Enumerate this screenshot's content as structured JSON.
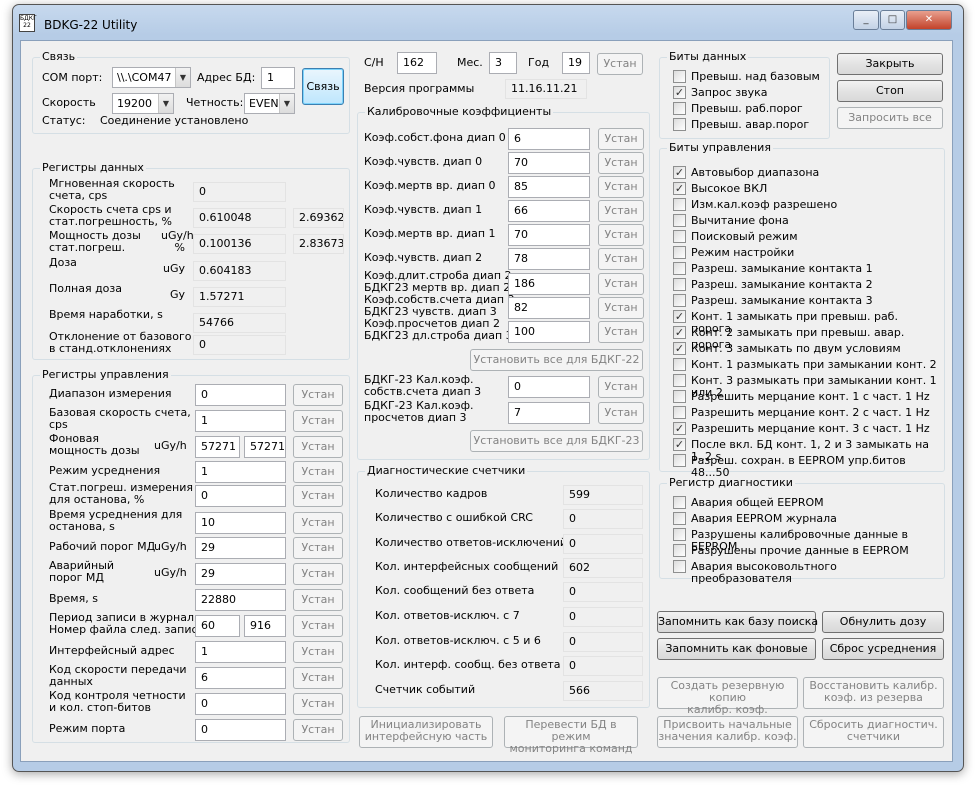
{
  "app": {
    "title": "BDKG-22 Utility",
    "icon_text": "БДКГ\n22",
    "caption_buttons": [
      "minimize-icon",
      "maximize-icon",
      "close-icon"
    ]
  },
  "link": {
    "title": "Связь",
    "com_label": "COM порт:",
    "com_value": "\\\\.\\COM47",
    "addr_label": "Адрес БД:",
    "addr_value": "1",
    "connect_btn": "Связь",
    "speed_label": "Скорость",
    "speed_value": "19200",
    "parity_label": "Четность:",
    "parity_value": "EVEN",
    "status_label": "Статус:",
    "status_value": "Соединение установлено"
  },
  "data_regs": {
    "title": "Регистры данных",
    "rows": [
      {
        "label": "Мгновенная скорость\nсчета, cps",
        "value": "0"
      },
      {
        "label": "Скорость счета cps и\nстат.погрешность, %",
        "value": "0.610048",
        "value2": "2.69362"
      },
      {
        "label": "Мощность дозы\nстат.погреш.",
        "unit": "uGy/h\n%",
        "value": "0.100136",
        "value2": "2.83673"
      },
      {
        "label": "Доза",
        "unit": "uGy",
        "value": "0.604183"
      },
      {
        "label": "Полная доза",
        "unit": "Gy",
        "value": "1.57271"
      },
      {
        "label": "Время наработки, s",
        "value": "54766"
      },
      {
        "label": "Отклонение от базового\nв станд.отклонениях",
        "value": "0"
      }
    ]
  },
  "ctrl_regs": {
    "title": "Регистры управления",
    "set_label": "Устан",
    "rows": [
      {
        "label": "Диапазон измерения",
        "value": "0"
      },
      {
        "label": "Базовая скорость счета,\ncps",
        "value": "1"
      },
      {
        "label": "Фоновая\nмощность дозы",
        "unit": "uGy/h",
        "value": "57271",
        "value2": "57271"
      },
      {
        "label": "Режим усреднения",
        "value": "1"
      },
      {
        "label": "Стат.погреш. измерения\nдля останова, %",
        "value": "0"
      },
      {
        "label": "Время усреднения для\nостанова, s",
        "value": "10"
      },
      {
        "label": "Рабочий порог МД",
        "unit": "uGy/h",
        "value": "29"
      },
      {
        "label": "Аварийный\nпорог МД",
        "unit": "uGy/h",
        "value": "29"
      },
      {
        "label": "Время, s",
        "value": "22880"
      },
      {
        "label": "Период записи в журнал,\nНомер файла след. записи",
        "value": "60",
        "value2": "916"
      },
      {
        "label": "Интерфейсный адрес",
        "value": "1"
      },
      {
        "label": "Код скорости передачи\nданных",
        "value": "6"
      },
      {
        "label": "Код контроля четности\nи кол. стоп-битов",
        "value": "0"
      },
      {
        "label": "Режим порта",
        "value": "0"
      }
    ]
  },
  "serial": {
    "sn_label": "С/Н",
    "sn": "162",
    "month_label": "Мес.",
    "month": "3",
    "year_label": "Год",
    "year": "19",
    "set": "Устан",
    "ver_label": "Версия программы",
    "ver": "11.16.11.21"
  },
  "calib": {
    "title": "Калибровочные коэффициенты",
    "set_label": "Устан",
    "rows": [
      {
        "label": "Коэф.собст.фона диап 0",
        "value": "6"
      },
      {
        "label": "Коэф.чувств. диап 0",
        "value": "70"
      },
      {
        "label": "Коэф.мертв вр. диап 0",
        "value": "85"
      },
      {
        "label": "Коэф.чувств. диап 1",
        "value": "66"
      },
      {
        "label": "Коэф.мертв вр. диап 1",
        "value": "70"
      },
      {
        "label": "Коэф.чувств. диап 2",
        "value": "78"
      },
      {
        "label": "Коэф.длит.строба диап 2\nБДКГ23 мертв вр. диап 2",
        "value": "186"
      },
      {
        "label": "Коэф.собств.счета диап 2\nБДКГ23 чувств. диап 3",
        "value": "82"
      },
      {
        "label": "Коэф.просчетов диап 2\nБДКГ23 дл.строба диап 3",
        "value": "100"
      }
    ],
    "set_all_22": "Установить все для БДКГ-22",
    "rows23": [
      {
        "label": "БДКГ-23 Кал.коэф.\nсобств.счета диап 3",
        "value": "0"
      },
      {
        "label": "БДКГ-23 Кал.коэф.\nпросчетов диап 3",
        "value": "7"
      }
    ],
    "set_all_23": "Установить все для БДКГ-23"
  },
  "diag_counters": {
    "title": "Диагностические счетчики",
    "rows": [
      {
        "label": "Количество кадров",
        "value": "599"
      },
      {
        "label": "Количество с ошибкой CRC",
        "value": "0"
      },
      {
        "label": "Количество ответов-исключений",
        "value": "0"
      },
      {
        "label": "Кол. интерфейсных сообщений",
        "value": "602"
      },
      {
        "label": "Кол. сообщений без ответа",
        "value": "0"
      },
      {
        "label": "Кол. ответов-исключ. с 7",
        "value": "0"
      },
      {
        "label": "Кол. ответов-исключ. с 5 и 6",
        "value": "0"
      },
      {
        "label": "Кол. интерф. сообщ. без ответа",
        "value": "0"
      },
      {
        "label": "Счетчик событий",
        "value": "566"
      }
    ]
  },
  "mid_buttons": {
    "init": "Инициализировать\nинтерфейсную часть",
    "monitor": "Перевести БД в режим\nмониторинга команд"
  },
  "data_bits": {
    "title": "Биты данных",
    "items": [
      {
        "label": "Превыш. над базовым",
        "checked": false
      },
      {
        "label": "Запрос звука",
        "checked": true
      },
      {
        "label": "Превыш. раб.порог",
        "checked": false
      },
      {
        "label": "Превыш. авар.порог",
        "checked": false
      }
    ]
  },
  "top_buttons": {
    "close": "Закрыть",
    "stop": "Стоп",
    "request_all": "Запросить все"
  },
  "ctrl_bits": {
    "title": "Биты управления",
    "items": [
      {
        "label": "Автовыбор диапазона",
        "checked": true
      },
      {
        "label": "Высокое ВКЛ",
        "checked": true
      },
      {
        "label": "Изм.кал.коэф разрешено",
        "checked": false
      },
      {
        "label": "Вычитание фона",
        "checked": false
      },
      {
        "label": "Поисковый режим",
        "checked": false
      },
      {
        "label": "Режим настройки",
        "checked": false
      },
      {
        "label": "Разреш. замыкание контакта 1",
        "checked": false
      },
      {
        "label": "Разреш. замыкание контакта 2",
        "checked": false
      },
      {
        "label": "Разреш. замыкание контакта 3",
        "checked": false
      },
      {
        "label": "Конт. 1 замыкать при превыш. раб. порога",
        "checked": true
      },
      {
        "label": "Конт. 2 замыкать при превыш. авар. порога",
        "checked": true
      },
      {
        "label": "Конт. 3 замыкать по двум условиям",
        "checked": true
      },
      {
        "label": "Конт. 1 размыкать при замыкании конт. 2",
        "checked": false
      },
      {
        "label": "Конт. 3 размыкать при замыкании конт. 1 или 2",
        "checked": false
      },
      {
        "label": "Разрешить мерцание конт. 1 с част. 1 Hz",
        "checked": false
      },
      {
        "label": "Разрешить мерцание конт. 2 с част. 1 Hz",
        "checked": false
      },
      {
        "label": "Разрешить мерцание конт. 3 с част. 1 Hz",
        "checked": true
      },
      {
        "label": "После вкл. БД конт. 1, 2 и 3 замыкать на 1..2 s",
        "checked": true
      },
      {
        "label": "Разреш. сохран. в EEPROM упр.битов 48...50",
        "checked": false
      }
    ]
  },
  "diag_reg": {
    "title": "Регистр диагностики",
    "items": [
      {
        "label": "Авария общей EEPROM",
        "checked": false
      },
      {
        "label": "Авария EEPROM журнала",
        "checked": false
      },
      {
        "label": "Разрушены калибровочные данные в EEPROM",
        "checked": false
      },
      {
        "label": "Разрушены прочие данные в EEPROM",
        "checked": false
      },
      {
        "label": "Авария высоковольтного преобразователя",
        "checked": false
      }
    ]
  },
  "bottom_buttons": {
    "save_search_base": "Запомнить как базу поиска",
    "reset_dose": "Обнулить дозу",
    "save_background": "Запомнить как фоновые",
    "reset_avg": "Сброс усреднения",
    "backup": "Создать резервную копию\nкалибр. коэф.",
    "restore": "Восстановить калибр.\nкоэф. из резерва",
    "assign_initial": "Присвоить начальные\nзначения калибр. коэф.",
    "reset_diag": "Сбросить диагностич.\nсчетчики"
  }
}
